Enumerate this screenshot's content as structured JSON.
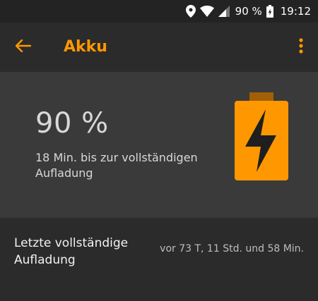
{
  "status_bar": {
    "battery_percent": "90 %",
    "time": "19:12",
    "icons": [
      "location-icon",
      "wifi-icon",
      "cell-signal-icon",
      "battery-charging-icon"
    ]
  },
  "app_bar": {
    "title": "Akku",
    "back_icon": "arrow-left-icon",
    "overflow_icon": "more-vert-icon"
  },
  "battery": {
    "percent": "90 %",
    "charge_info": "18 Min. bis zur vollständigen Aufladung",
    "icon": "battery-charging-icon",
    "level": 0.9
  },
  "list": {
    "last_full_charge_label": "Letzte vollständige Aufladung",
    "last_full_charge_value": "vor 73 T, 11 Std. und 58 Min."
  },
  "colors": {
    "accent": "#ff9800",
    "status_bar": "#232323",
    "background": "#2b2b2b",
    "card": "#3a3a3a"
  }
}
